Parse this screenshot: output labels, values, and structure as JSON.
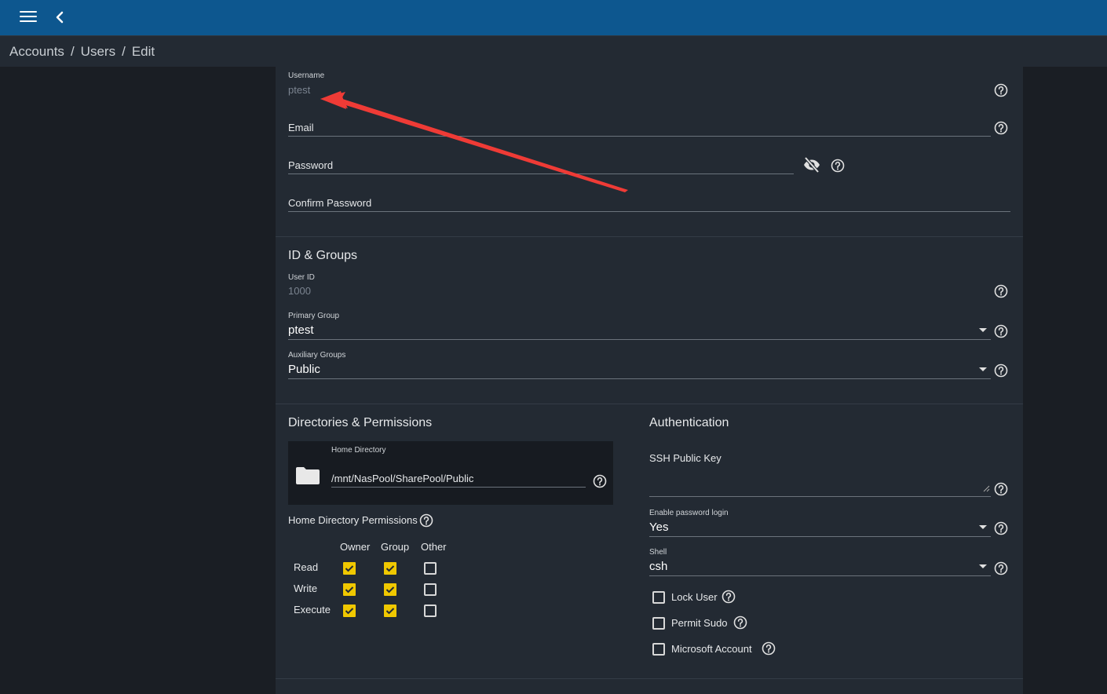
{
  "topbar": {
    "menu_icon": "menu-icon",
    "back_icon": "chevron-left-icon"
  },
  "breadcrumb": {
    "items": [
      "Accounts",
      "Users",
      "Edit"
    ],
    "separator": "/"
  },
  "identification": {
    "username_label": "Username",
    "username_value": "ptest",
    "email_label": "Email",
    "password_label": "Password",
    "confirm_password_label": "Confirm Password"
  },
  "id_groups": {
    "title": "ID & Groups",
    "user_id_label": "User ID",
    "user_id_value": "1000",
    "primary_group_label": "Primary Group",
    "primary_group_value": "ptest",
    "auxiliary_groups_label": "Auxiliary Groups",
    "auxiliary_groups_value": "Public"
  },
  "directories": {
    "title": "Directories & Permissions",
    "home_dir_label": "Home Directory",
    "home_dir_value": "/mnt/NasPool/SharePool/Public",
    "permissions_label": "Home Directory Permissions",
    "columns": [
      "Owner",
      "Group",
      "Other"
    ],
    "rows": [
      {
        "label": "Read",
        "owner": true,
        "group": true,
        "other": false
      },
      {
        "label": "Write",
        "owner": true,
        "group": true,
        "other": false
      },
      {
        "label": "Execute",
        "owner": true,
        "group": true,
        "other": false
      }
    ]
  },
  "authentication": {
    "title": "Authentication",
    "ssh_key_label": "SSH Public Key",
    "password_login_label": "Enable password login",
    "password_login_value": "Yes",
    "shell_label": "Shell",
    "shell_value": "csh",
    "lock_user_label": "Lock User",
    "lock_user_checked": false,
    "permit_sudo_label": "Permit Sudo",
    "permit_sudo_checked": false,
    "microsoft_account_label": "Microsoft Account",
    "microsoft_account_checked": false
  },
  "colors": {
    "topbar": "#0d578f",
    "panel": "#232a33",
    "background": "#1a1e24",
    "checkbox_on": "#f0c800",
    "annotation_arrow": "#ef3b36"
  }
}
